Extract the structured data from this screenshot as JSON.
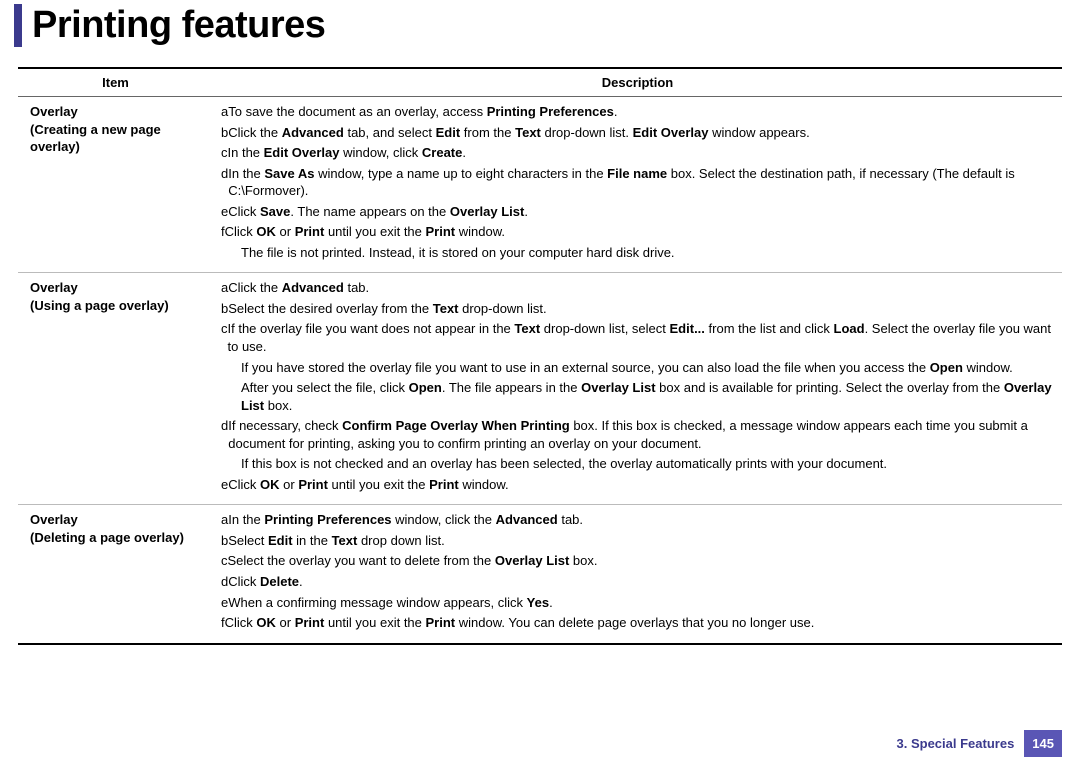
{
  "title": "Printing features",
  "table": {
    "headers": {
      "item": "Item",
      "description": "Description"
    },
    "rows": [
      {
        "title": "Overlay",
        "subtitle_open": "(",
        "subtitle": "Creating a new page overlay",
        "subtitle_close": ")",
        "steps": [
          {
            "l": "a",
            "html": "To save the document as an overlay, access <b>Printing Preferences</b>."
          },
          {
            "l": "b",
            "html": "Click the <b>Advanced</b> tab, and select <b>Edit</b> from the <b>Text</b> drop-down list. <b>Edit Overlay</b> window appears."
          },
          {
            "l": "c",
            "html": "In the <b>Edit Overlay</b> window, click <b>Create</b>."
          },
          {
            "l": "d",
            "html": "In the <b>Save As</b> window, type a name up to eight characters in the <b>File name</b> box. Select the destination path, if necessary (The default is C:\\Formover)."
          },
          {
            "l": "e",
            "html": "Click <b>Save</b>. The name appears on the <b>Overlay List</b>."
          },
          {
            "l": "f",
            "html": "Click <b>OK</b> or <b>Print</b> until you exit the <b>Print</b> window."
          },
          {
            "cont": true,
            "html": "The file is not printed. Instead, it is stored on your computer hard disk drive."
          }
        ]
      },
      {
        "title": "Overlay",
        "subtitle_open": "(",
        "subtitle": "Using a page overlay",
        "subtitle_close": ")",
        "steps": [
          {
            "l": "a",
            "html": "Click the <b>Advanced</b> tab."
          },
          {
            "l": "b",
            "html": "Select the desired overlay from the <b>Text</b> drop-down list."
          },
          {
            "l": "c",
            "html": "If the overlay file you want does not appear in the <b>Text</b> drop-down list, select <b>Edit...</b> from the list and click <b>Load</b>. Select the overlay file you want to use."
          },
          {
            "cont": true,
            "html": "If you have stored the overlay file you want to use in an external source, you can also load the file when you access the <b>Open</b> window."
          },
          {
            "cont": true,
            "html": "After you select the file, click <b>Open</b>. The file appears in the <b>Overlay List</b> box and is available for printing. Select the overlay from the <b>Overlay List</b> box."
          },
          {
            "l": "d",
            "html": "If necessary, check <b>Confirm Page Overlay When Printing</b> box. If this box is checked, a message window appears each time you submit a document for printing, asking you to confirm printing an overlay on your document."
          },
          {
            "cont": true,
            "html": "If this box is not checked and an overlay has been selected, the overlay automatically prints with your document."
          },
          {
            "l": "e",
            "html": "Click <b>OK</b> or <b>Print</b> until you exit the <b>Print</b> window."
          }
        ]
      },
      {
        "title": "Overlay",
        "subtitle_open": "(",
        "subtitle": "Deleting a page overlay",
        "subtitle_close": ")",
        "steps": [
          {
            "l": "a",
            "html": "In the <b>Printing Preferences</b> window, click the <b>Advanced</b> tab."
          },
          {
            "l": "b",
            "html": "Select <b>Edit</b> in the <b>Text</b> drop down list."
          },
          {
            "l": "c",
            "html": "Select the overlay you want to delete from the <b>Overlay List</b> box."
          },
          {
            "l": "d",
            "html": "Click <b>Delete</b>."
          },
          {
            "l": "e",
            "html": "When a confirming message window appears, click <b>Yes</b>."
          },
          {
            "l": "f",
            "html": "Click <b>OK</b> or <b>Print</b> until you exit the <b>Print</b> window. You can delete page overlays that you no longer use."
          }
        ]
      }
    ]
  },
  "footer": {
    "section": "3.  Special Features",
    "page": "145"
  }
}
